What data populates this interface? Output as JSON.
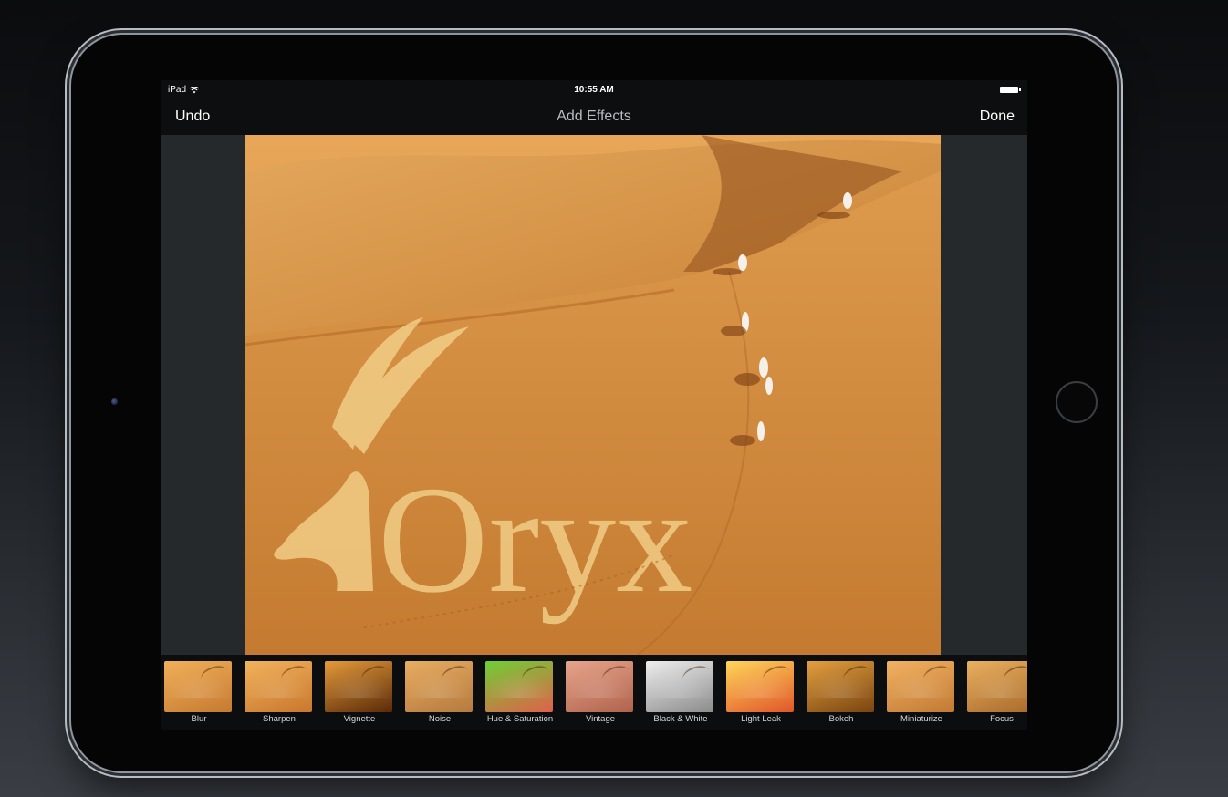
{
  "status_bar": {
    "device": "iPad",
    "time": "10:55 AM"
  },
  "nav": {
    "left": "Undo",
    "title": "Add Effects",
    "right": "Done"
  },
  "photo": {
    "watermark_text": "Oryx"
  },
  "effects": [
    {
      "label": "Blur",
      "colors": [
        "#f0b05a",
        "#c67a30"
      ]
    },
    {
      "label": "Sharpen",
      "colors": [
        "#f1b35d",
        "#c9772c"
      ]
    },
    {
      "label": "Vignette",
      "colors": [
        "#e39a3a",
        "#5a2a08"
      ]
    },
    {
      "label": "Noise",
      "colors": [
        "#e8ad62",
        "#b57a3e"
      ]
    },
    {
      "label": "Hue & Saturation",
      "colors": [
        "#6fcf35",
        "#e0604a"
      ]
    },
    {
      "label": "Vintage",
      "colors": [
        "#e7a58c",
        "#b0624c"
      ]
    },
    {
      "label": "Black & White",
      "colors": [
        "#eeeeee",
        "#8b8b8b"
      ]
    },
    {
      "label": "Light Leak",
      "colors": [
        "#ffd65a",
        "#e0562a"
      ]
    },
    {
      "label": "Bokeh",
      "colors": [
        "#e3a040",
        "#7a4410"
      ]
    },
    {
      "label": "Miniaturize",
      "colors": [
        "#f2b262",
        "#c27a34"
      ]
    },
    {
      "label": "Focus",
      "colors": [
        "#eab060",
        "#a86a2a"
      ]
    }
  ],
  "colors": {
    "sand": "#d9954a",
    "sand_shadow": "#b56a28",
    "watermark": "#f3d089"
  }
}
